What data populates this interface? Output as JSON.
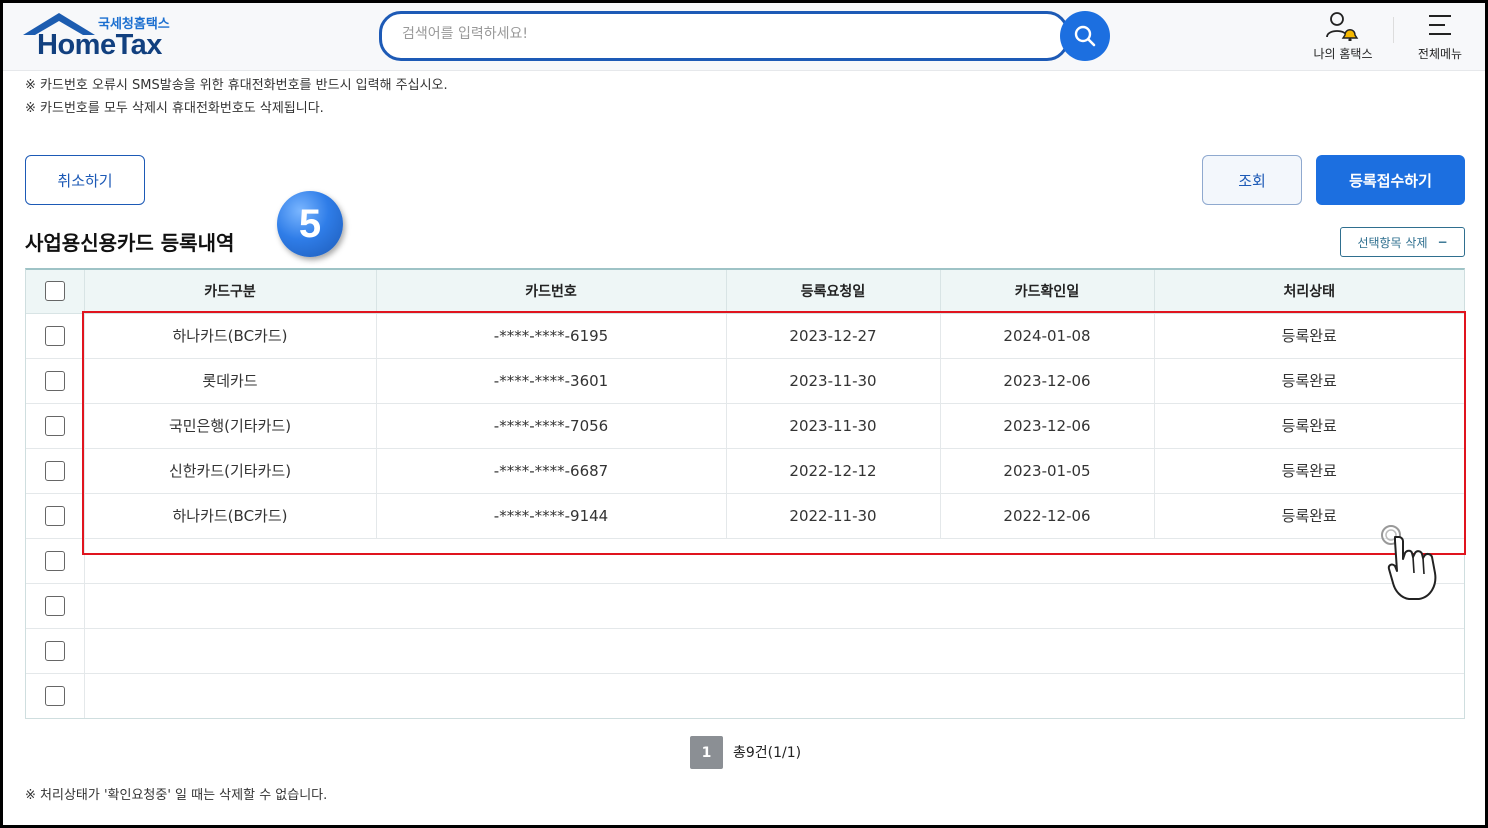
{
  "header": {
    "logo_sub": "국세청홈택스",
    "logo_main": "HomeTax",
    "search_placeholder": "검색어를 입력하세요!",
    "my_hometax_label": "나의 홈택스",
    "all_menu_label": "전체메뉴",
    "icons": {
      "search": "search-icon",
      "user": "user-bell-icon",
      "menu": "hamburger-icon"
    }
  },
  "notices": [
    "※ 카드번호 오류시 SMS발송을 위한 휴대전화번호를 반드시 입력해 주십시오.",
    "※ 카드번호를 모두 삭제시 휴대전화번호도 삭제됩니다."
  ],
  "buttons": {
    "cancel": "취소하기",
    "inquiry": "조회",
    "register": "등록접수하기",
    "delete_selected": "선택항목 삭제",
    "delete_selected_icon": "−"
  },
  "section_title": "사업용신용카드 등록내역",
  "step_badge": "5",
  "table": {
    "headers": [
      "카드구분",
      "카드번호",
      "등록요청일",
      "카드확인일",
      "처리상태"
    ],
    "rows": [
      {
        "card_type": "하나카드(BC카드)",
        "card_no": "-****-****-6195",
        "request_date": "2023-12-27",
        "confirm_date": "2024-01-08",
        "status": "등록완료"
      },
      {
        "card_type": "롯데카드",
        "card_no": "-****-****-3601",
        "request_date": "2023-11-30",
        "confirm_date": "2023-12-06",
        "status": "등록완료"
      },
      {
        "card_type": "국민은행(기타카드)",
        "card_no": "-****-****-7056",
        "request_date": "2023-11-30",
        "confirm_date": "2023-12-06",
        "status": "등록완료"
      },
      {
        "card_type": "신한카드(기타카드)",
        "card_no": "-****-****-6687",
        "request_date": "2022-12-12",
        "confirm_date": "2023-01-05",
        "status": "등록완료"
      },
      {
        "card_type": "하나카드(BC카드)",
        "card_no": "-****-****-9144",
        "request_date": "2022-11-30",
        "confirm_date": "2022-12-06",
        "status": "등록완료"
      }
    ],
    "empty_rows": 4
  },
  "pagination": {
    "current_page": "1",
    "total_text": "총9건(1/1)"
  },
  "footer_notice": "※ 처리상태가 '확인요청중' 일 때는 삭제할 수 없습니다.",
  "colors": {
    "brand_blue": "#1c6fe0",
    "highlight_red": "#e0141e",
    "header_bg": "#eef6f6"
  }
}
